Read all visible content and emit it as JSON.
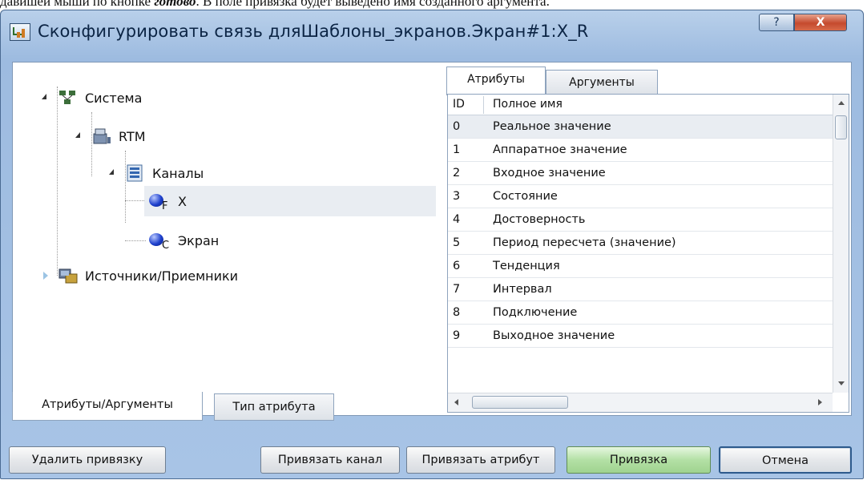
{
  "doc": {
    "text_before": "давишей мыши по кнопке ",
    "text_italic": "готово",
    "text_after": ". В поле привязка будет выведено имя созданного аргумента."
  },
  "window": {
    "title": "Сконфигурировать связь дляШаблоны_экранов.Экран#1:X_R",
    "help_label": "?",
    "close_label": "X"
  },
  "tree": {
    "items": [
      {
        "label": "Система",
        "icon": "system-network-icon",
        "expanded": true
      },
      {
        "label": "RTM",
        "icon": "rtm-server-icon",
        "expanded": true
      },
      {
        "label": "Каналы",
        "icon": "channels-list-icon",
        "expanded": true
      },
      {
        "label": "X",
        "icon": "channel-ball-icon",
        "subscript": "F",
        "selected": true
      },
      {
        "label": "Экран",
        "icon": "channel-ball-icon",
        "subscript": "C"
      },
      {
        "label": "Источники/Приемники",
        "icon": "sources-receivers-icon",
        "expanded": false
      }
    ]
  },
  "right_tabs": [
    {
      "label": "Атрибуты",
      "active": true
    },
    {
      "label": "Аргументы",
      "active": false
    }
  ],
  "grid": {
    "columns": [
      "ID",
      "Полное имя"
    ],
    "rows": [
      {
        "id": "0",
        "name": "Реальное значение",
        "selected": true
      },
      {
        "id": "1",
        "name": "Аппаратное значение"
      },
      {
        "id": "2",
        "name": "Входное значение"
      },
      {
        "id": "3",
        "name": "Состояние"
      },
      {
        "id": "4",
        "name": "Достоверность"
      },
      {
        "id": "5",
        "name": "Период пересчета (значение)"
      },
      {
        "id": "6",
        "name": "Тенденция"
      },
      {
        "id": "7",
        "name": "Интервал"
      },
      {
        "id": "8",
        "name": "Подключение"
      },
      {
        "id": "9",
        "name": "Выходное значение"
      }
    ]
  },
  "bottom_tabs": [
    {
      "label": "Атрибуты/Аргументы",
      "active": true
    },
    {
      "label": "Тип атрибута",
      "active": false
    }
  ],
  "buttons": {
    "remove_binding": "Удалить привязку",
    "bind_channel": "Привязать канал",
    "bind_attribute": "Привязать атрибут",
    "binding": "Привязка",
    "cancel": "Отмена"
  },
  "colors": {
    "titlebar": "#a8c4e6",
    "selection": "#e9edf2",
    "green_button": "#b3e0a5",
    "close_button": "#c54a2e"
  }
}
